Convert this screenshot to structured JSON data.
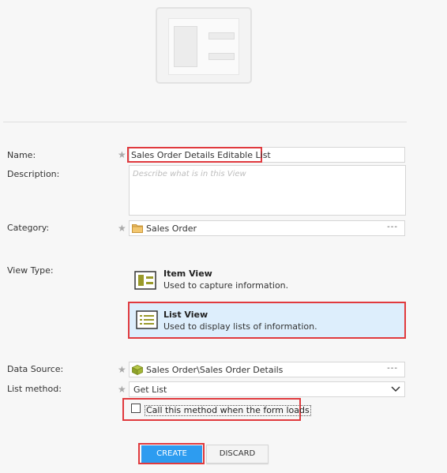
{
  "form": {
    "name_label": "Name:",
    "name_value": "Sales Order Details Editable List",
    "description_label": "Description:",
    "description_placeholder": "Describe what is in this View",
    "category_label": "Category:",
    "category_value": "Sales Order",
    "view_type_label": "View Type:",
    "view_types": [
      {
        "title": "Item View",
        "description": "Used to capture information."
      },
      {
        "title": "List View",
        "description": "Used to display lists of information."
      }
    ],
    "data_source_label": "Data Source:",
    "data_source_value": "Sales Order\\Sales Order Details",
    "list_method_label": "List method:",
    "list_method_value": "Get List",
    "call_method_label": "Call this method when the form loads",
    "call_method_checked": false,
    "required_marker": "★",
    "ellipsis": "---"
  },
  "buttons": {
    "create": "CREATE",
    "discard": "DISCARD"
  },
  "colors": {
    "highlight": "#e03a3e",
    "accent": "#2d9cf0",
    "selected_bg": "#ddeefc"
  }
}
